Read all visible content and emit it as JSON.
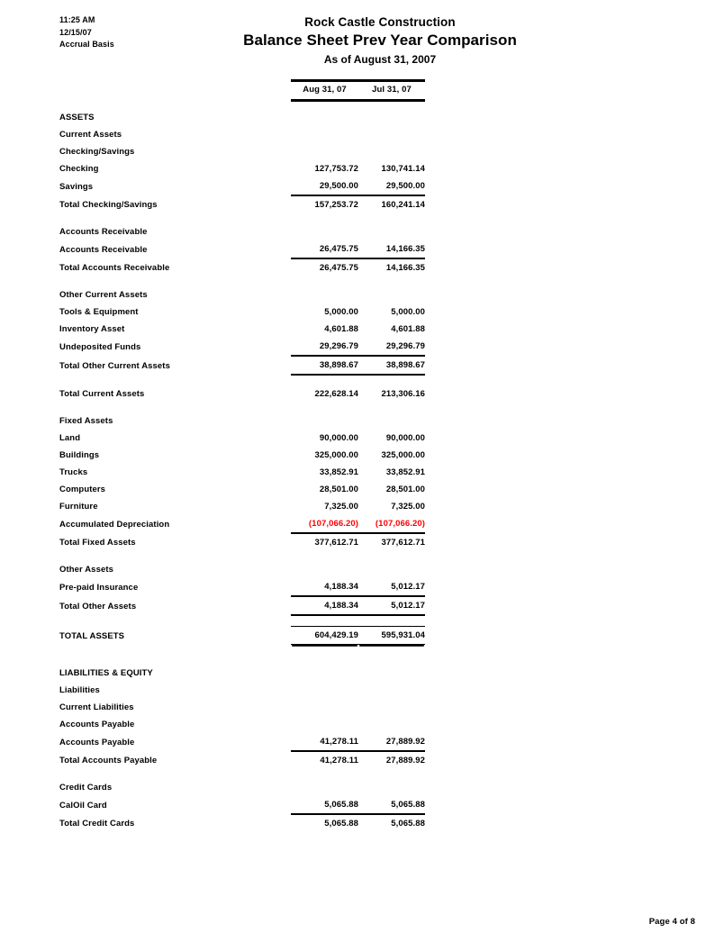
{
  "header": {
    "time": "11:25 AM",
    "date": "12/15/07",
    "basis": "Accrual Basis",
    "company": "Rock Castle Construction",
    "report_title": "Balance Sheet Prev Year Comparison",
    "as_of": "As of August 31, 2007"
  },
  "columns": {
    "label": "",
    "col1": "Aug 31, 07",
    "col2": "Jul 31, 07"
  },
  "colors": {
    "negative": "#FF0000",
    "text": "#000000",
    "background": "#FFFFFF"
  },
  "rows": [
    {
      "label": "ASSETS",
      "indent": 0,
      "v1": "",
      "v2": ""
    },
    {
      "label": "Current Assets",
      "indent": 1,
      "v1": "",
      "v2": ""
    },
    {
      "label": "Checking/Savings",
      "indent": 2,
      "v1": "",
      "v2": ""
    },
    {
      "label": "Checking",
      "indent": 3,
      "v1": "127,753.72",
      "v2": "130,741.14"
    },
    {
      "label": "Savings",
      "indent": 3,
      "v1": "29,500.00",
      "v2": "29,500.00",
      "rule_below": true
    },
    {
      "label": "Total Checking/Savings",
      "indent": 2,
      "v1": "157,253.72",
      "v2": "160,241.14"
    },
    {
      "spacer": true
    },
    {
      "label": "Accounts Receivable",
      "indent": 2,
      "v1": "",
      "v2": ""
    },
    {
      "label": "Accounts Receivable",
      "indent": 3,
      "v1": "26,475.75",
      "v2": "14,166.35",
      "rule_below": true
    },
    {
      "label": "Total Accounts Receivable",
      "indent": 2,
      "v1": "26,475.75",
      "v2": "14,166.35"
    },
    {
      "spacer": true
    },
    {
      "label": "Other Current Assets",
      "indent": 2,
      "v1": "",
      "v2": ""
    },
    {
      "label": "Tools & Equipment",
      "indent": 3,
      "v1": "5,000.00",
      "v2": "5,000.00"
    },
    {
      "label": "Inventory Asset",
      "indent": 3,
      "v1": "4,601.88",
      "v2": "4,601.88"
    },
    {
      "label": "Undeposited Funds",
      "indent": 3,
      "v1": "29,296.79",
      "v2": "29,296.79",
      "rule_below": true
    },
    {
      "label": "Total Other Current Assets",
      "indent": 2,
      "v1": "38,898.67",
      "v2": "38,898.67",
      "rule_below": true
    },
    {
      "spacer": true
    },
    {
      "label": "Total Current Assets",
      "indent": 1,
      "v1": "222,628.14",
      "v2": "213,306.16"
    },
    {
      "spacer": true
    },
    {
      "label": "Fixed Assets",
      "indent": 1,
      "v1": "",
      "v2": ""
    },
    {
      "label": "Land",
      "indent": 2,
      "v1": "90,000.00",
      "v2": "90,000.00"
    },
    {
      "label": "Buildings",
      "indent": 2,
      "v1": "325,000.00",
      "v2": "325,000.00"
    },
    {
      "label": "Trucks",
      "indent": 2,
      "v1": "33,852.91",
      "v2": "33,852.91"
    },
    {
      "label": "Computers",
      "indent": 2,
      "v1": "28,501.00",
      "v2": "28,501.00"
    },
    {
      "label": "Furniture",
      "indent": 2,
      "v1": "7,325.00",
      "v2": "7,325.00"
    },
    {
      "label": "Accumulated Depreciation",
      "indent": 2,
      "v1": "(107,066.20)",
      "v2": "(107,066.20)",
      "negative": true,
      "rule_below": true
    },
    {
      "label": "Total Fixed Assets",
      "indent": 1,
      "v1": "377,612.71",
      "v2": "377,612.71"
    },
    {
      "spacer": true
    },
    {
      "label": "Other Assets",
      "indent": 1,
      "v1": "",
      "v2": ""
    },
    {
      "label": "Pre-paid Insurance",
      "indent": 2,
      "v1": "4,188.34",
      "v2": "5,012.17",
      "rule_below": true
    },
    {
      "label": "Total Other Assets",
      "indent": 1,
      "v1": "4,188.34",
      "v2": "5,012.17",
      "rule_below": true
    },
    {
      "spacer": true
    },
    {
      "label": "TOTAL ASSETS",
      "indent": 0,
      "v1": "604,429.19",
      "v2": "595,931.04",
      "rule_above_thin": true,
      "double_below": true
    },
    {
      "spacer": true
    },
    {
      "spacer": true
    },
    {
      "label": "LIABILITIES & EQUITY",
      "indent": 0,
      "v1": "",
      "v2": ""
    },
    {
      "label": "Liabilities",
      "indent": 1,
      "v1": "",
      "v2": ""
    },
    {
      "label": "Current Liabilities",
      "indent": 2,
      "v1": "",
      "v2": ""
    },
    {
      "label": "Accounts Payable",
      "indent": 3,
      "v1": "",
      "v2": ""
    },
    {
      "label": "Accounts Payable",
      "indent": 4,
      "v1": "41,278.11",
      "v2": "27,889.92",
      "rule_below": true
    },
    {
      "label": "Total Accounts Payable",
      "indent": 3,
      "v1": "41,278.11",
      "v2": "27,889.92"
    },
    {
      "spacer": true
    },
    {
      "label": "Credit Cards",
      "indent": 3,
      "v1": "",
      "v2": ""
    },
    {
      "label": "CalOil Card",
      "indent": 4,
      "v1": "5,065.88",
      "v2": "5,065.88",
      "rule_below": true
    },
    {
      "label": "Total Credit Cards",
      "indent": 3,
      "v1": "5,065.88",
      "v2": "5,065.88"
    }
  ],
  "footer": {
    "page_label": "Page 4 of 8"
  }
}
